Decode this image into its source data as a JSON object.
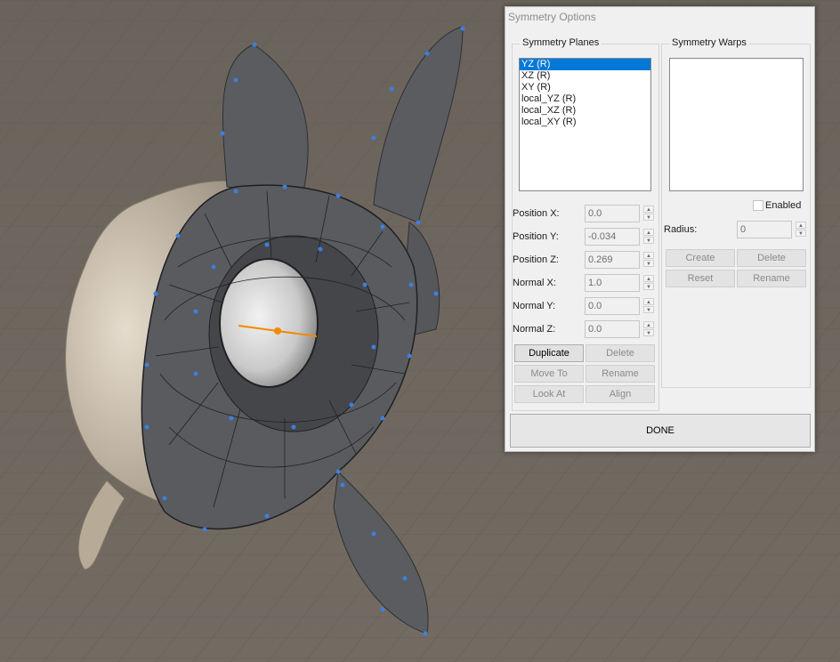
{
  "dialog": {
    "title": "Symmetry Options",
    "done_label": "DONE"
  },
  "planes": {
    "group_label": "Symmetry Planes",
    "items": [
      {
        "label": "YZ (R)",
        "selected": true
      },
      {
        "label": "XZ (R)",
        "selected": false
      },
      {
        "label": "XY (R)",
        "selected": false
      },
      {
        "label": "local_YZ (R)",
        "selected": false
      },
      {
        "label": "local_XZ (R)",
        "selected": false
      },
      {
        "label": "local_XY (R)",
        "selected": false
      }
    ],
    "position_x": {
      "label": "Position X:",
      "value": "0.0"
    },
    "position_y": {
      "label": "Position Y:",
      "value": "-0.034"
    },
    "position_z": {
      "label": "Position Z:",
      "value": "0.269"
    },
    "normal_x": {
      "label": "Normal X:",
      "value": "1.0"
    },
    "normal_y": {
      "label": "Normal Y:",
      "value": "0.0"
    },
    "normal_z": {
      "label": "Normal Z:",
      "value": "0.0"
    },
    "buttons": {
      "duplicate": "Duplicate",
      "delete": "Delete",
      "move_to": "Move To",
      "rename": "Rename",
      "look_at": "Look At",
      "align": "Align"
    }
  },
  "warps": {
    "group_label": "Symmetry Warps",
    "enabled_label": "Enabled",
    "enabled_checked": false,
    "radius": {
      "label": "Radius:",
      "value": "0"
    },
    "buttons": {
      "create": "Create",
      "delete": "Delete",
      "reset": "Reset",
      "rename": "Rename"
    }
  },
  "colors": {
    "selection": "#0078d7",
    "viewport_bg": "#6e675f",
    "mesh_gray": "#4a4c50",
    "vertex_blue": "#3d7fe0",
    "axis_orange": "#f08a00"
  }
}
